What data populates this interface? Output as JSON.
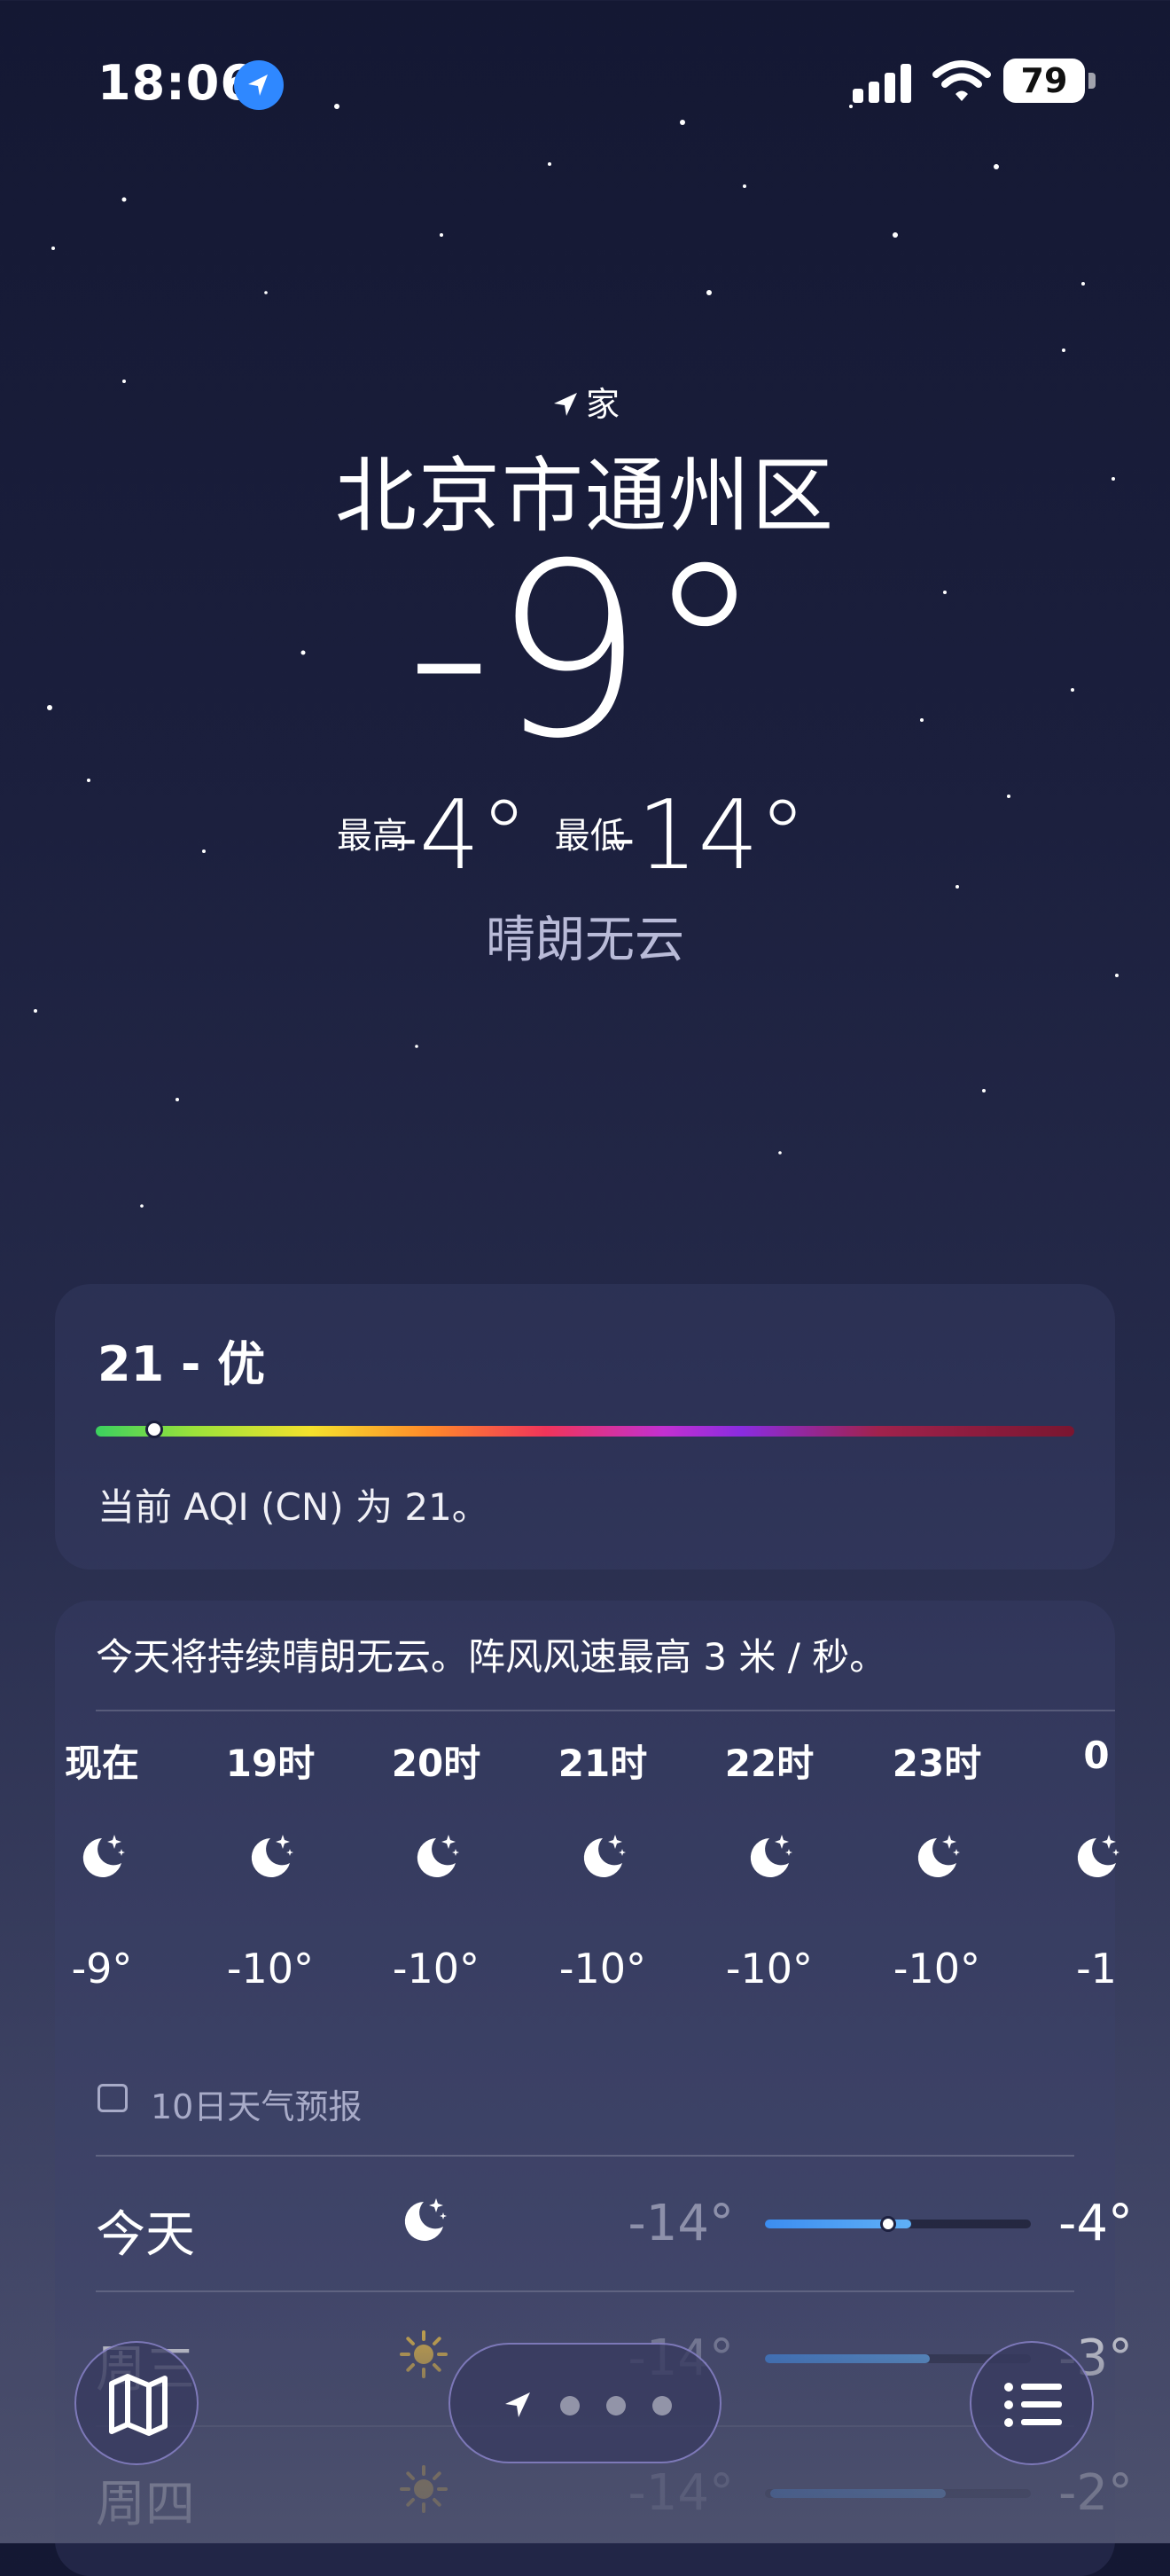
{
  "status_bar": {
    "time": "18:06",
    "battery": "79"
  },
  "location": {
    "home_label": "家",
    "city": "北京市通州区"
  },
  "current": {
    "temperature": "-9°",
    "high_label": "最高",
    "high": "-4°",
    "low_label": "最低",
    "low": "-14°",
    "condition": "晴朗无云"
  },
  "aqi": {
    "value": "21 - 优",
    "description": "当前 AQI (CN) 为 21。",
    "level": 0.047
  },
  "forecast": {
    "summary": "今天将持续晴朗无云。阵风风速最高 3 米 / 秒。",
    "hourly": [
      {
        "label": "现在",
        "icon": "moon-stars-icon",
        "temp": "-9°"
      },
      {
        "label": "19时",
        "icon": "moon-stars-icon",
        "temp": "-10°"
      },
      {
        "label": "20时",
        "icon": "moon-stars-icon",
        "temp": "-10°"
      },
      {
        "label": "21时",
        "icon": "moon-stars-icon",
        "temp": "-10°"
      },
      {
        "label": "22时",
        "icon": "moon-stars-icon",
        "temp": "-10°"
      },
      {
        "label": "23时",
        "icon": "moon-stars-icon",
        "temp": "-10°"
      },
      {
        "label": "0",
        "icon": "moon-stars-icon",
        "temp": "-1"
      }
    ],
    "ten_day_title": "10日天气预报",
    "daily": [
      {
        "day": "今天",
        "icon": "moon-stars-icon",
        "low": "-14°",
        "high": "-4°"
      },
      {
        "day": "周三",
        "icon": "sun-icon",
        "low": "-14°",
        "high": "-3°"
      },
      {
        "day": "周四",
        "icon": "sun-icon",
        "low": "-14°",
        "high": "-2°"
      }
    ]
  },
  "colors": {
    "accent": "#2f88ff",
    "background": "#1b1f3d",
    "temp_bar": "#3c8df0"
  }
}
